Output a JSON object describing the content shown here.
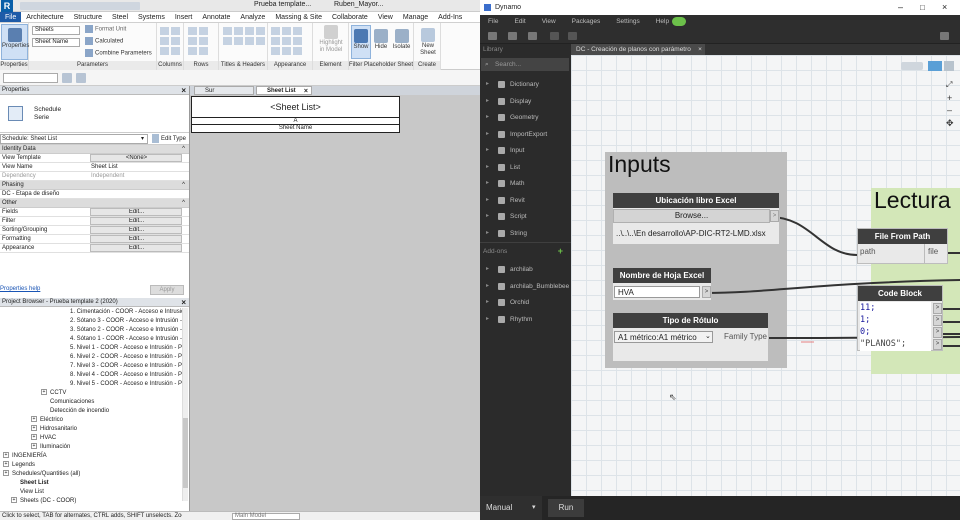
{
  "revit": {
    "title_file": "Prueba template...",
    "title_user": "Ruben_Mayor...",
    "menus": [
      "File",
      "Architecture",
      "Structure",
      "Steel",
      "Systems",
      "Insert",
      "Annotate",
      "Analyze",
      "Massing & Site",
      "Collaborate",
      "View",
      "Manage",
      "Add-Ins"
    ],
    "ribbon": {
      "properties_btn": "Properties",
      "sheets_sel": "Sheets",
      "sheet_name_sel": "Sheet Name",
      "format_unit": "Format Unit",
      "calculated": "Calculated",
      "combine": "Combine Parameters",
      "highlight1": "Highlight",
      "highlight2": "in Model",
      "show": "Show",
      "hide": "Hide",
      "isolate": "Isolate",
      "new1": "New",
      "new2": "Sheet",
      "groups": [
        "Properties",
        "Parameters",
        "Columns",
        "Rows",
        "Titles & Headers",
        "Appearance",
        "Element",
        "Filter Placeholder Sheets",
        "Create"
      ]
    },
    "properties": {
      "header": "Properties",
      "type_name1": "Schedule",
      "type_name2": "Serie",
      "selector": "Schedule: Sheet List",
      "edit_type": "Edit Type",
      "sections": {
        "identity": "Identity Data",
        "phasing": "Phasing",
        "other": "Other"
      },
      "identity_rows": [
        {
          "k": "View Template",
          "v": "<None>"
        },
        {
          "k": "View Name",
          "v": "Sheet List"
        },
        {
          "k": "Dependency",
          "v": "Independent"
        }
      ],
      "phasing_rows": [
        {
          "k": "DC - Etapa de diseño",
          "v": ""
        }
      ],
      "other_rows": [
        {
          "k": "Fields",
          "v": "Edit..."
        },
        {
          "k": "Filter",
          "v": "Edit..."
        },
        {
          "k": "Sorting/Grouping",
          "v": "Edit..."
        },
        {
          "k": "Formatting",
          "v": "Edit..."
        },
        {
          "k": "Appearance",
          "v": "Edit..."
        }
      ],
      "help_link": "Properties help",
      "apply": "Apply"
    },
    "browser": {
      "header": "Project Browser - Prueba template 2 (2020)",
      "items": [
        "1. Cimentación - COOR - Acceso e Intrusión",
        "2. Sótano 3 - COOR - Acceso e Intrusión -",
        "3. Sótano 2 - COOR - Acceso e Intrusión -",
        "4. Sótano 1 - COOR - Acceso e Intrusión -",
        "5. Nivel 1 - COOR - Acceso e Intrusión - P",
        "6. Nivel 2 - COOR - Acceso e Intrusión - P",
        "7. Nivel 3 - COOR - Acceso e Intrusión - P",
        "8. Nivel 4 - COOR - Acceso e Intrusión - P",
        "9. Nivel 5 - COOR - Acceso e Intrusión - P",
        "CCTV",
        "Comunicaciones",
        "Detección de incendio",
        "Eléctrico",
        "Hidrosanitario",
        "HVAC",
        "Iluminación",
        "INGENIERÍA",
        "Legends",
        "Schedules/Quantities (all)",
        "Sheet List",
        "View List",
        "Sheets (DC - COOR)"
      ]
    },
    "tabs": {
      "tab1": "Sur",
      "tab2": "Sheet List"
    },
    "schedule": {
      "title": "<Sheet List>",
      "col_letter": "A",
      "col_name": "Sheet Name"
    },
    "status": {
      "text": "Click to select, TAB for alternates, CTRL adds, SHIFT unselects. Zoom in or out using th",
      "model": "Main Model"
    }
  },
  "dynamo": {
    "title": "Dynamo",
    "menus": [
      "File",
      "Edit",
      "View",
      "Packages",
      "Settings",
      "Help"
    ],
    "library": {
      "header": "Library",
      "search_placeholder": "Search...",
      "categories": [
        "Dictionary",
        "Display",
        "Geometry",
        "ImportExport",
        "Input",
        "List",
        "Math",
        "Revit",
        "Script",
        "String"
      ],
      "addons_label": "Add-ons",
      "addons": [
        "archilab",
        "archilab_Bumblebee",
        "Orchid",
        "Rhythm"
      ]
    },
    "workspace_tab": "DC - Creación de planos con parámetro",
    "groups": {
      "inputs": "Inputs",
      "lectura": "Lectura"
    },
    "nodes": {
      "excel_title": "Ubicación libro Excel",
      "browse": "Browse...",
      "excel_path": "..\\..\\..\\En desarrollo\\AP-DIC-RT2-LMD.xlsx",
      "sheet_title": "Nombre de Hoja Excel",
      "sheet_value": "HVA",
      "tipo_title": "Tipo de Rótulo",
      "tipo_value": "A1 métrico:A1 métrico",
      "tipo_port": "Family Type",
      "ffp_title": "File From Path",
      "ffp_in": "path",
      "ffp_out": "file",
      "code_title": "Code Block",
      "code_lines": [
        "11;",
        "1;",
        "0;",
        "\"PLANOS\";"
      ]
    },
    "run_mode": "Manual",
    "run_btn": "Run"
  }
}
